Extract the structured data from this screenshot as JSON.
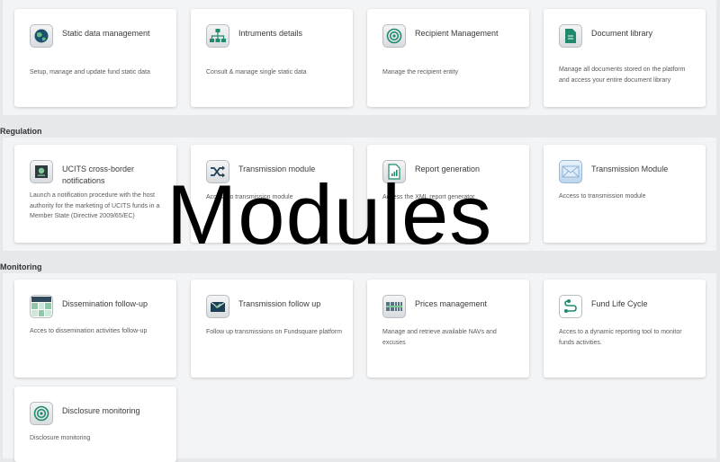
{
  "sections": [
    {
      "label": ""
    },
    {
      "label": "Regulation"
    },
    {
      "label": "Monitoring"
    }
  ],
  "cards": [
    {
      "title": "Static data management",
      "desc": "Setup, manage and update fund static data",
      "icon": "globe-icon"
    },
    {
      "title": "Intruments details",
      "desc": "Consult & manage single static data",
      "icon": "hierarchy-icon"
    },
    {
      "title": "Recipient Management",
      "desc": "Manage the recipient entity",
      "icon": "target-icon"
    },
    {
      "title": "Document library",
      "desc": "Manage all documents stored on the platform and access your entire document library",
      "icon": "document-icon"
    },
    {
      "title": "UCITS cross-border notifications",
      "desc": "Launch a notification procedure with the host authority for the marketing of UCITS funds in a Member State (Directive 2009/65/EC)",
      "icon": "certificate-icon"
    },
    {
      "title": "Transmission module",
      "desc": "Access to transmission module",
      "icon": "shuffle-icon"
    },
    {
      "title": "Report generation",
      "desc": "Access the XML report generator",
      "icon": "report-icon"
    },
    {
      "title": "Transmission Module",
      "desc": "Access to transmission module",
      "icon": "envelope-icon"
    },
    {
      "title": "Dissemination follow-up",
      "desc": "Acces to dissemination activities follow-up",
      "icon": "grid-icon"
    },
    {
      "title": "Transmission follow up",
      "desc": "Follow up transmissions on Fundsquare platform",
      "icon": "mail-check-icon"
    },
    {
      "title": "Prices management",
      "desc": "Manage and retrieve available NAVs and excuses",
      "icon": "barcode-icon"
    },
    {
      "title": "Fund Life Cycle",
      "desc": "Acces to a dynamic reporting tool to monitor funds activities.",
      "icon": "path-icon"
    },
    {
      "title": "Disclosure monitoring",
      "desc": "Disclosure monitoring",
      "icon": "target-icon"
    }
  ],
  "overlay_text": "Modules",
  "colors": {
    "accent": "#1f8a6e",
    "background": "#e6e8eb",
    "panel": "#f3f4f5"
  }
}
